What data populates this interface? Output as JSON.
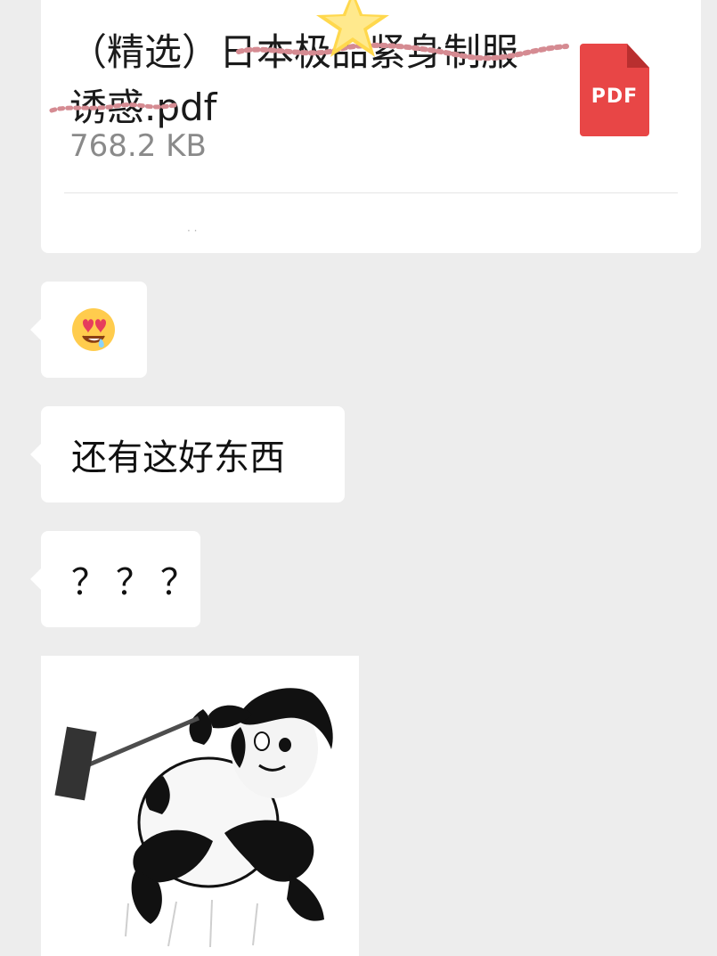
{
  "file_card": {
    "name": "（精选）日本极品紧身制服诱惑.pdf",
    "size": "768.2 KB",
    "icon_label": "PDF"
  },
  "messages": [
    {
      "type": "emoji",
      "icon": "heart-eyes-drool-emoji-icon"
    },
    {
      "type": "text",
      "text": "还有这好东西"
    },
    {
      "type": "text",
      "text": "？？？"
    },
    {
      "type": "sticker",
      "icon": "panda-meme-sticker"
    }
  ],
  "colors": {
    "background": "#ededed",
    "bubble": "#ffffff",
    "pdf_red": "#e84646",
    "muted_text": "#8a8a8a"
  }
}
